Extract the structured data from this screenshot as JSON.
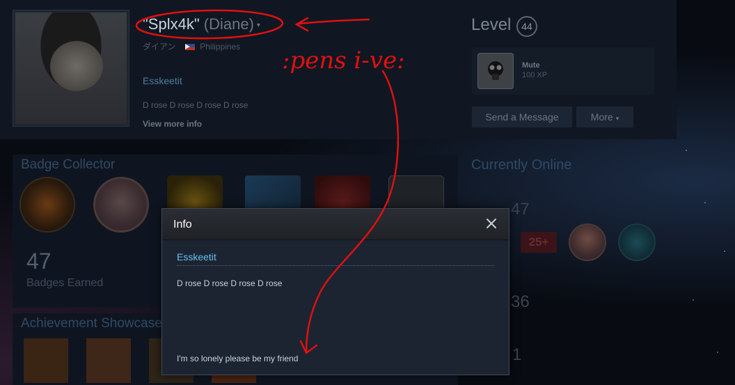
{
  "profile": {
    "persona_name": "\"Splx4k\"",
    "real_name": "(Diane)",
    "dropdown_caret": "▾",
    "alias": "ダイアン",
    "country": "Philippines",
    "summary_link": "Esskeetit",
    "summary_text": "D rose D rose D rose D rose",
    "view_more": "View more info"
  },
  "level": {
    "label": "Level",
    "value": "44"
  },
  "favorite_badge": {
    "name": "Mute",
    "xp": "100 XP",
    "icon": "gas-mask-icon"
  },
  "actions": {
    "send_message": "Send a Message",
    "more": "More",
    "more_caret": "▾"
  },
  "badge_collector": {
    "title": "Badge Collector",
    "count": "47",
    "count_label": "Badges Earned"
  },
  "achievement_showcase": {
    "title": "Achievement Showcase"
  },
  "right_column": {
    "title": "Currently Online",
    "num1": "47",
    "plus": "25+",
    "num2": "36",
    "num3": "1"
  },
  "modal": {
    "title": "Info",
    "close_glyph": "✕",
    "link_text": "Esskeetit",
    "body_text": "D rose D rose D rose D rose",
    "footer_text": "I'm so lonely please be my friend"
  },
  "annotation": {
    "handwritten_text": ":pens i-ve:",
    "color": "#e01010"
  },
  "colors": {
    "link": "#66c0f4",
    "modal_bg": "#1c2431",
    "page_bg": "#0b0f15"
  }
}
